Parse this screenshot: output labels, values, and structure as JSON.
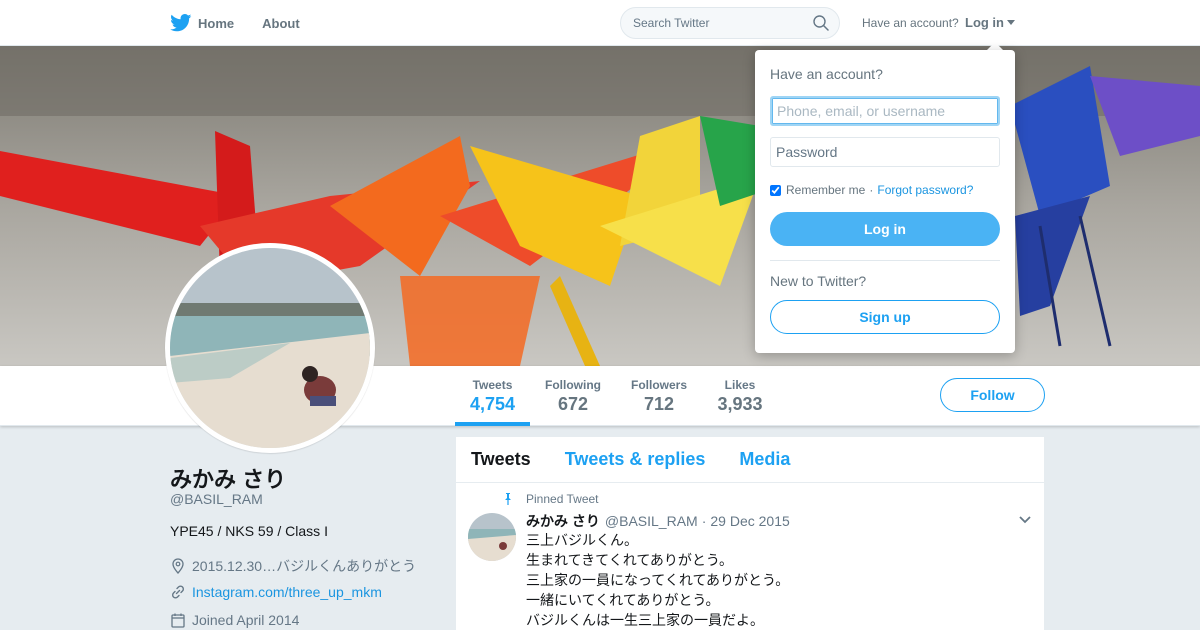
{
  "nav": {
    "home_label": "Home",
    "about_label": "About",
    "search_placeholder": "Search Twitter",
    "have_account": "Have an account?",
    "login_label": "Log in"
  },
  "profile": {
    "name": "みかみ さり",
    "handle": "@BASIL_RAM",
    "bio": "YPE45 / NKS 59 / Class I",
    "location": "2015.12.30…バジルくんありがとう",
    "website": "Instagram.com/three_up_mkm",
    "joined": "Joined April 2014"
  },
  "stats": [
    {
      "label": "Tweets",
      "value": "4,754"
    },
    {
      "label": "Following",
      "value": "672"
    },
    {
      "label": "Followers",
      "value": "712"
    },
    {
      "label": "Likes",
      "value": "3,933"
    }
  ],
  "follow_label": "Follow",
  "timeline": {
    "tabs": [
      "Tweets",
      "Tweets & replies",
      "Media"
    ],
    "pinned_label": "Pinned Tweet",
    "tweet": {
      "name": "みかみ さり",
      "handle": "@BASIL_RAM",
      "dot": "·",
      "date": "29 Dec 2015",
      "lines": [
        "三上バジルくん。",
        "生まれてきてくれてありがとう。",
        "三上家の一員になってくれてありがとう。",
        "一緒にいてくれてありがとう。",
        "バジルくんは一生三上家の一員だよ。"
      ]
    }
  },
  "login_dropdown": {
    "title": "Have an account?",
    "username_placeholder": "Phone, email, or username",
    "password_placeholder": "Password",
    "remember_label": "Remember me",
    "separator": "·",
    "forgot_label": "Forgot password?",
    "login_button": "Log in",
    "new_label": "New to Twitter?",
    "signup_button": "Sign up"
  },
  "colors": {
    "accent": "#1da1f2",
    "login_button": "#4ab3f4",
    "background": "#e6ecf0"
  }
}
